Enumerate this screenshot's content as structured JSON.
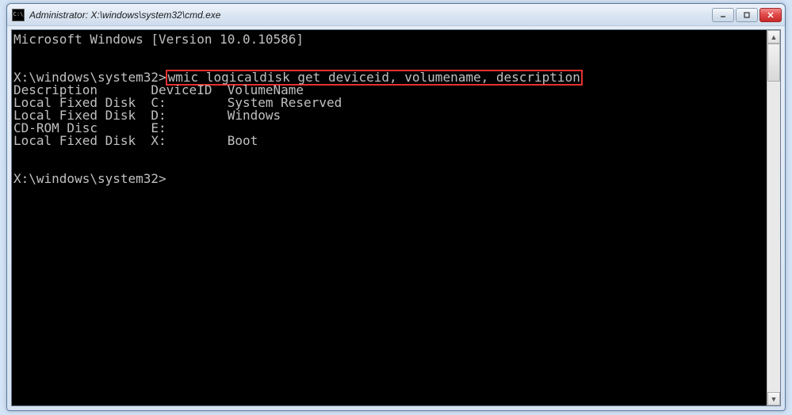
{
  "window": {
    "title": "Administrator: X:\\windows\\system32\\cmd.exe"
  },
  "terminal": {
    "banner": "Microsoft Windows [Version 10.0.10586]",
    "prompt1_path": "X:\\windows\\system32>",
    "command": "wmic logicaldisk get deviceid, volumename, description",
    "header": {
      "description": "Description",
      "deviceid": "DeviceID",
      "volumename": "VolumeName"
    },
    "rows": [
      {
        "description": "Local Fixed Disk",
        "deviceid": "C:",
        "volumename": "System Reserved"
      },
      {
        "description": "Local Fixed Disk",
        "deviceid": "D:",
        "volumename": "Windows"
      },
      {
        "description": "CD-ROM Disc",
        "deviceid": "E:",
        "volumename": ""
      },
      {
        "description": "Local Fixed Disk",
        "deviceid": "X:",
        "volumename": "Boot"
      }
    ],
    "prompt2_path": "X:\\windows\\system32>"
  }
}
